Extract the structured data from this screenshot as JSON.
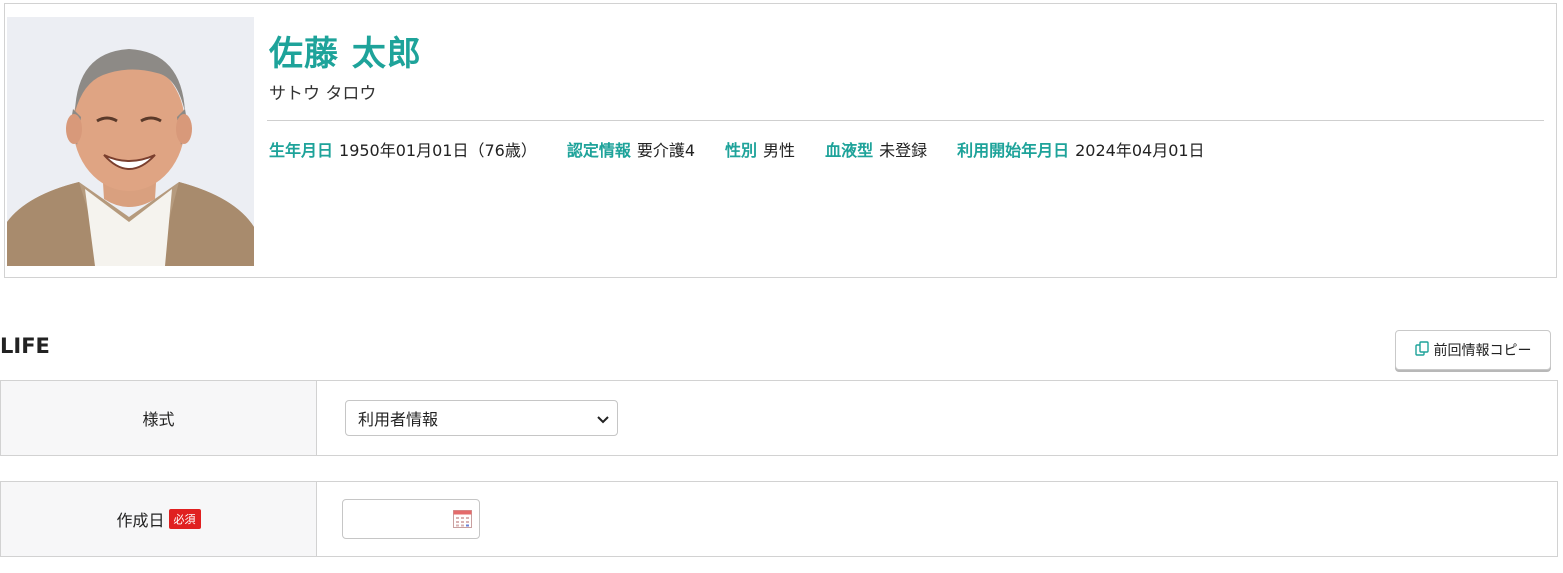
{
  "profile": {
    "name": "佐藤 太郎",
    "kana": "サトウ タロウ",
    "info": [
      {
        "label": "生年月日",
        "value": "1950年01月01日（76歳）"
      },
      {
        "label": "認定情報",
        "value": "要介護4"
      },
      {
        "label": "性別",
        "value": "男性"
      },
      {
        "label": "血液型",
        "value": "未登録"
      },
      {
        "label": "利用開始年月日",
        "value": "2024年04月01日"
      }
    ]
  },
  "section": {
    "title": "LIFE",
    "copy_button_label": "前回情報コピー"
  },
  "form": {
    "style_label": "様式",
    "style_selected": "利用者情報",
    "date_label": "作成日",
    "required_badge": "必須",
    "date_value": ""
  },
  "colors": {
    "accent": "#1ea39a",
    "required": "#e02020"
  }
}
